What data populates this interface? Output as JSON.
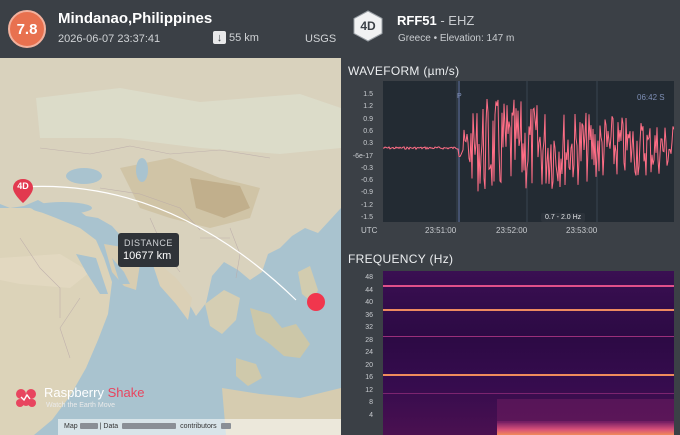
{
  "quake": {
    "magnitude": "7.8",
    "place": "Mindanao,Philippines",
    "time": "2026-06-07 23:37:41",
    "depth_icon": "arrow-down-icon",
    "depth": "55 km",
    "source": "USGS"
  },
  "map": {
    "distance_label": "DISTANCE",
    "distance_value": "10677 km",
    "station_pin": "4D",
    "brand_main": "Raspberry",
    "brand_accent": "Shake",
    "brand_tagline": "Watch the Earth Move",
    "attribution": {
      "a": "Map",
      "b": "| Data",
      "c": "contributors"
    }
  },
  "station": {
    "badge": "4D",
    "code": "RFF51",
    "separator": " - ",
    "channel": "EHZ",
    "location": "Greece • Elevation: 147 m"
  },
  "waveform": {
    "title": "WAVEFORM (µm/s)",
    "y_ticks": [
      "1.5",
      "1.2",
      "0.9",
      "0.6",
      "0.3",
      "-6e-17",
      "-0.3",
      "-0.6",
      "-0.9",
      "-1.2",
      "-1.5"
    ],
    "x_ticks": [
      "UTC",
      "23:51:00",
      "23:52:00",
      "23:53:00"
    ],
    "filter": "0.7 - 2.0 Hz",
    "p_marker": "P",
    "time_marker": "06:42 S"
  },
  "spectrogram": {
    "title": "FREQUENCY (Hz)",
    "y_ticks": [
      "48",
      "44",
      "40",
      "36",
      "32",
      "28",
      "24",
      "20",
      "16",
      "12",
      "8",
      "4"
    ]
  },
  "colors": {
    "magnitude": "#e8714f",
    "waveform_line": "#ff6e86",
    "epicenter": "#f1364d",
    "brand_red": "#e8455f"
  }
}
